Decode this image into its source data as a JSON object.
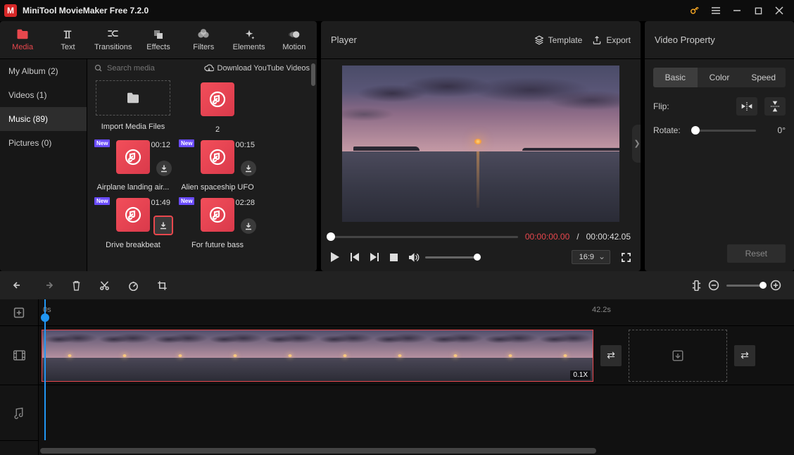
{
  "app": {
    "title": "MiniTool MovieMaker Free 7.2.0"
  },
  "toolbar": [
    {
      "key": "media",
      "label": "Media",
      "icon": "folder-icon",
      "active": true
    },
    {
      "key": "text",
      "label": "Text",
      "icon": "text-icon",
      "active": false
    },
    {
      "key": "transitions",
      "label": "Transitions",
      "icon": "transition-icon",
      "active": false
    },
    {
      "key": "effects",
      "label": "Effects",
      "icon": "layers-icon",
      "active": false
    },
    {
      "key": "filters",
      "label": "Filters",
      "icon": "circles-icon",
      "active": false
    },
    {
      "key": "elements",
      "label": "Elements",
      "icon": "sparkle-icon",
      "active": false
    },
    {
      "key": "motion",
      "label": "Motion",
      "icon": "motion-icon",
      "active": false
    }
  ],
  "sidebar": [
    {
      "label": "My Album (2)",
      "active": false
    },
    {
      "label": "Videos (1)",
      "active": false
    },
    {
      "label": "Music (89)",
      "active": true
    },
    {
      "label": "Pictures (0)",
      "active": false
    }
  ],
  "search": {
    "placeholder": "Search media"
  },
  "download_link": "Download YouTube Videos",
  "media": [
    {
      "kind": "import",
      "label": "Import Media Files"
    },
    {
      "kind": "music",
      "label": "2"
    },
    {
      "kind": "music",
      "label": "Airplane landing air...",
      "dur": "00:12",
      "is_new": true,
      "dl": true
    },
    {
      "kind": "music",
      "label": "Alien spaceship UFO",
      "dur": "00:15",
      "is_new": true,
      "dl": true
    },
    {
      "kind": "music",
      "label": "Drive breakbeat",
      "dur": "01:49",
      "is_new": true,
      "dl": true,
      "highlight_dl": true
    },
    {
      "kind": "music",
      "label": "For future bass",
      "dur": "02:28",
      "is_new": true,
      "dl": true
    }
  ],
  "player": {
    "title": "Player",
    "template_label": "Template",
    "export_label": "Export",
    "cur_time": "00:00:00.00",
    "total_time": "00:00:42.05",
    "ratio": "16:9"
  },
  "props": {
    "title": "Video Property",
    "tabs": [
      {
        "label": "Basic",
        "active": true
      },
      {
        "label": "Color",
        "active": false
      },
      {
        "label": "Speed",
        "active": false
      }
    ],
    "flip_label": "Flip:",
    "rotate_label": "Rotate:",
    "rotate_value": "0°",
    "reset_label": "Reset"
  },
  "timeline": {
    "t_start": "0s",
    "t_end": "42.2s",
    "clip_speed": "0.1X"
  },
  "badges": {
    "new": "New"
  }
}
